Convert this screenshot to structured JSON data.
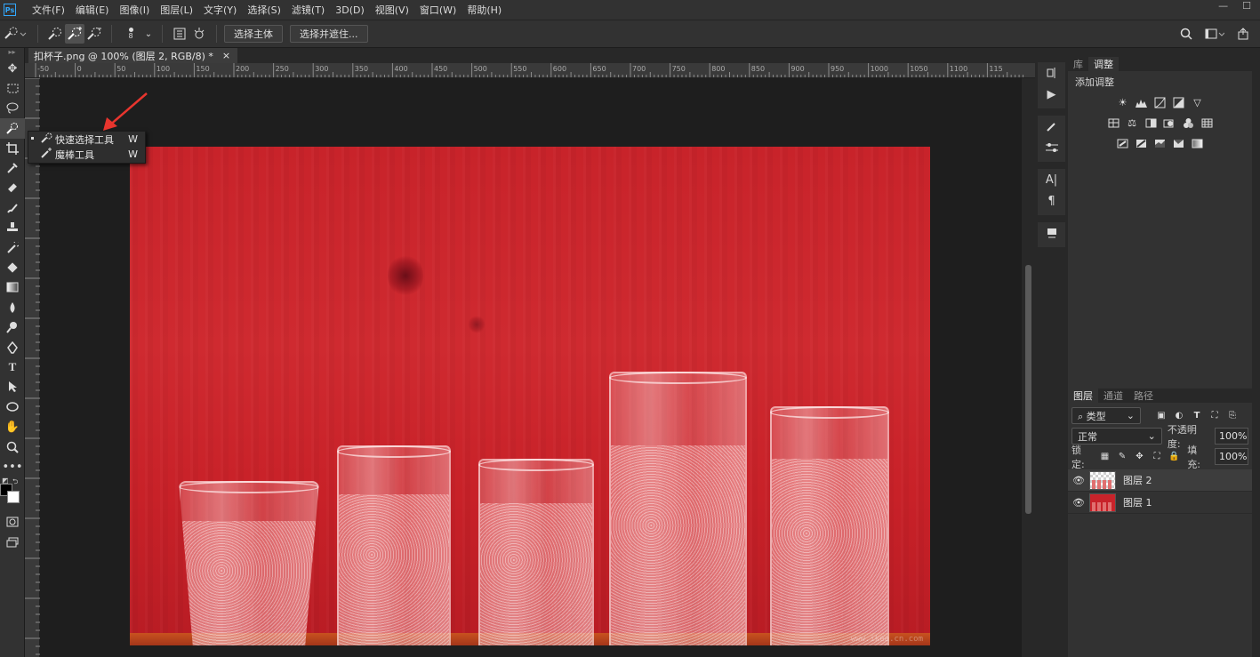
{
  "app": {
    "logo": "Ps"
  },
  "menu": [
    "文件(F)",
    "编辑(E)",
    "图像(I)",
    "图层(L)",
    "文字(Y)",
    "选择(S)",
    "滤镜(T)",
    "3D(D)",
    "视图(V)",
    "窗口(W)",
    "帮助(H)"
  ],
  "window_controls": {
    "minimize": "—",
    "maximize": "☐",
    "close": "✕"
  },
  "options": {
    "brush_size": "8",
    "select_subject": "选择主体",
    "select_and_mask": "选择并遮住..."
  },
  "document": {
    "tab_title": "扣杯子.png @ 100% (图层 2, RGB/8) *",
    "close_glyph": "×",
    "watermark": "www.ikea.cn.com"
  },
  "ruler": {
    "ticks": [
      "-50",
      "0",
      "50",
      "100",
      "150",
      "200",
      "250",
      "300",
      "350",
      "400",
      "450",
      "500",
      "550",
      "600",
      "650",
      "700",
      "750",
      "800",
      "850",
      "900",
      "950",
      "1000",
      "1050",
      "1100",
      "115"
    ]
  },
  "flyout": {
    "items": [
      {
        "label": "快速选择工具",
        "key": "W",
        "icon": "quick-selection-icon"
      },
      {
        "label": "魔棒工具",
        "key": "W",
        "icon": "magic-wand-icon"
      }
    ]
  },
  "panels": {
    "top_tabs": [
      "库",
      "调整"
    ],
    "adjustments_title": "添加调整",
    "layers_tabs": [
      "图层",
      "通道",
      "路径"
    ],
    "filter_kind": "类型",
    "blend_mode": "正常",
    "opacity_label": "不透明度:",
    "opacity_value": "100%",
    "lock_label": "锁定:",
    "fill_label": "填充:",
    "fill_value": "100%",
    "layers": [
      {
        "name": "图层 2",
        "selected": true
      },
      {
        "name": "图层 1",
        "selected": false
      }
    ]
  },
  "colors": {
    "accent": "#31a8ff",
    "arrow": "#e8352e",
    "photo_red": "#c8232a"
  }
}
